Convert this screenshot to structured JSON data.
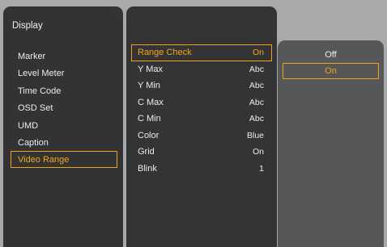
{
  "category": {
    "title": "Display"
  },
  "left_menu": {
    "items": [
      {
        "label": "Marker"
      },
      {
        "label": "Level Meter"
      },
      {
        "label": "Time Code"
      },
      {
        "label": "OSD Set"
      },
      {
        "label": "UMD"
      },
      {
        "label": "Caption"
      },
      {
        "label": "Video Range",
        "selected": true
      }
    ]
  },
  "mid_menu": {
    "items": [
      {
        "label": "Range Check",
        "value": "On",
        "selected": true
      },
      {
        "label": "Y Max",
        "value": "Abc"
      },
      {
        "label": "Y Min",
        "value": "Abc"
      },
      {
        "label": "C Max",
        "value": "Abc"
      },
      {
        "label": "C Min",
        "value": "Abc"
      },
      {
        "label": "Color",
        "value": "Blue"
      },
      {
        "label": "Grid",
        "value": "On"
      },
      {
        "label": "Blink",
        "value": "1"
      }
    ]
  },
  "options_menu": {
    "items": [
      {
        "label": "Off"
      },
      {
        "label": "On",
        "selected": true
      }
    ]
  },
  "colors": {
    "background": "#a9a9ab",
    "panel": "#333335",
    "options_panel": "#575759",
    "accent": "#f0a412"
  }
}
